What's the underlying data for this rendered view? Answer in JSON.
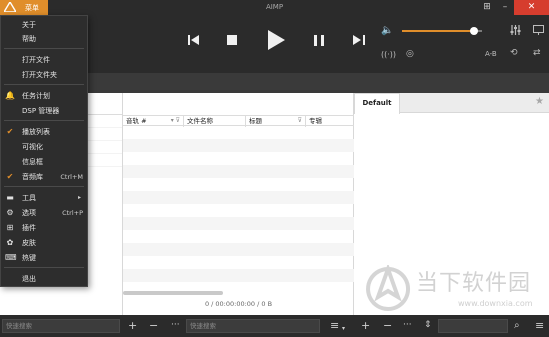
{
  "app": {
    "title": "AIMP",
    "menu_button_label": "菜单"
  },
  "colors": {
    "accent": "#e08e2b",
    "dark": "#2b2b2b",
    "close": "#d63d2e"
  },
  "player": {
    "volume_fraction": 0.9,
    "ab_label": "A-B",
    "icons": [
      "prev-icon",
      "stop-icon",
      "play-icon",
      "pause-icon",
      "next-icon",
      "volume-icon",
      "equalizer-icon",
      "screen-icon",
      "radio-icon",
      "record-icon",
      "repeat-icon",
      "shuffle-icon"
    ]
  },
  "menu": {
    "items": [
      {
        "label": "关于",
        "icon": "",
        "checked": false,
        "shortcut": "",
        "submenu": false
      },
      {
        "label": "帮助",
        "icon": "",
        "checked": false,
        "shortcut": "",
        "submenu": false
      },
      {
        "label": "打开文件",
        "icon": "",
        "checked": false,
        "shortcut": "",
        "submenu": false
      },
      {
        "label": "打开文件夹",
        "icon": "",
        "checked": false,
        "shortcut": "",
        "submenu": false
      },
      {
        "label": "任务计划",
        "icon": "bell-icon",
        "checked": false,
        "shortcut": "",
        "submenu": false
      },
      {
        "label": "DSP 管理器",
        "icon": "",
        "checked": false,
        "shortcut": "",
        "submenu": false
      },
      {
        "label": "播放列表",
        "icon": "check-icon",
        "checked": true,
        "shortcut": "",
        "submenu": false
      },
      {
        "label": "可视化",
        "icon": "",
        "checked": false,
        "shortcut": "",
        "submenu": false
      },
      {
        "label": "信息框",
        "icon": "",
        "checked": false,
        "shortcut": "",
        "submenu": false
      },
      {
        "label": "音频库",
        "icon": "check-icon",
        "checked": true,
        "shortcut": "Ctrl+M",
        "submenu": false
      },
      {
        "label": "工具",
        "icon": "toolbox-icon",
        "checked": false,
        "shortcut": "",
        "submenu": true
      },
      {
        "label": "选项",
        "icon": "gear-icon",
        "checked": false,
        "shortcut": "Ctrl+P",
        "submenu": false
      },
      {
        "label": "插件",
        "icon": "plugins-icon",
        "checked": false,
        "shortcut": "",
        "submenu": false
      },
      {
        "label": "皮肤",
        "icon": "palette-icon",
        "checked": false,
        "shortcut": "",
        "submenu": false
      },
      {
        "label": "热键",
        "icon": "keyboard-icon",
        "checked": false,
        "shortcut": "",
        "submenu": false
      },
      {
        "label": "退出",
        "icon": "",
        "checked": false,
        "shortcut": "",
        "submenu": false
      }
    ]
  },
  "playlist": {
    "columns": [
      {
        "label": "音轨 #"
      },
      {
        "label": "文件名称"
      },
      {
        "label": "标题"
      },
      {
        "label": "专辑"
      }
    ],
    "status": "0 / 00:00:00:00 / 0 B"
  },
  "right_panel": {
    "tab_label": "Default",
    "watermark_text": "当下软件园",
    "watermark_url": "www.downxia.com"
  },
  "bottom": {
    "left_search_placeholder": "快速搜索",
    "right_search_placeholder": "快速搜索"
  }
}
